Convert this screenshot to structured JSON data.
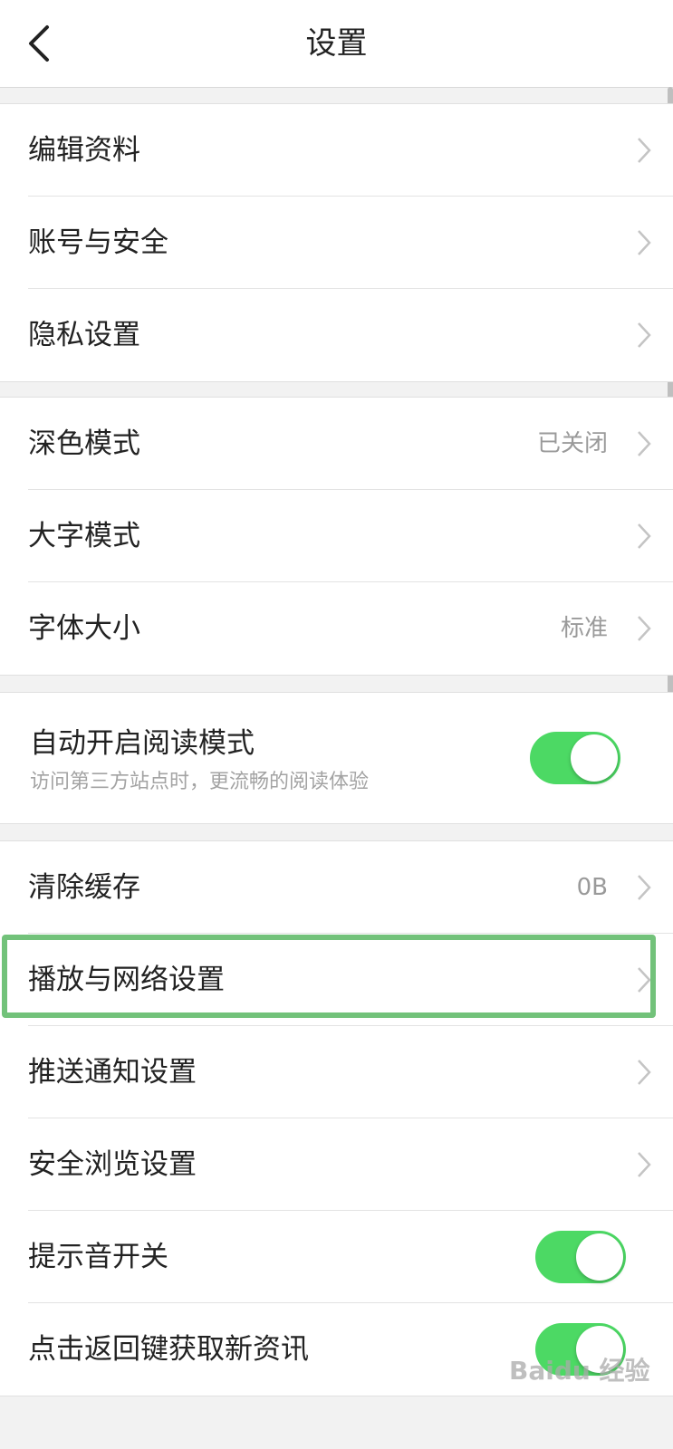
{
  "header": {
    "title": "设置",
    "back_icon": "chevron-left-icon"
  },
  "groups": [
    {
      "items": [
        {
          "label": "编辑资料"
        },
        {
          "label": "账号与安全"
        },
        {
          "label": "隐私设置"
        }
      ]
    },
    {
      "items": [
        {
          "label": "深色模式",
          "value": "已关闭"
        },
        {
          "label": "大字模式"
        },
        {
          "label": "字体大小",
          "value": "标准"
        }
      ]
    },
    {
      "reading_mode": {
        "label": "自动开启阅读模式",
        "description": "访问第三方站点时，更流畅的阅读体验",
        "enabled": true
      }
    },
    {
      "items": [
        {
          "label": "清除缓存",
          "value": "0B"
        },
        {
          "label": "播放与网络设置"
        },
        {
          "label": "推送通知设置"
        },
        {
          "label": "安全浏览设置"
        },
        {
          "label": "提示音开关",
          "toggle": true
        },
        {
          "label": "点击返回键获取新资讯",
          "toggle": true
        }
      ]
    }
  ],
  "colors": {
    "toggle_on": "#4cd964",
    "highlight": "#72c27a"
  },
  "watermark": "Baidu 经验"
}
